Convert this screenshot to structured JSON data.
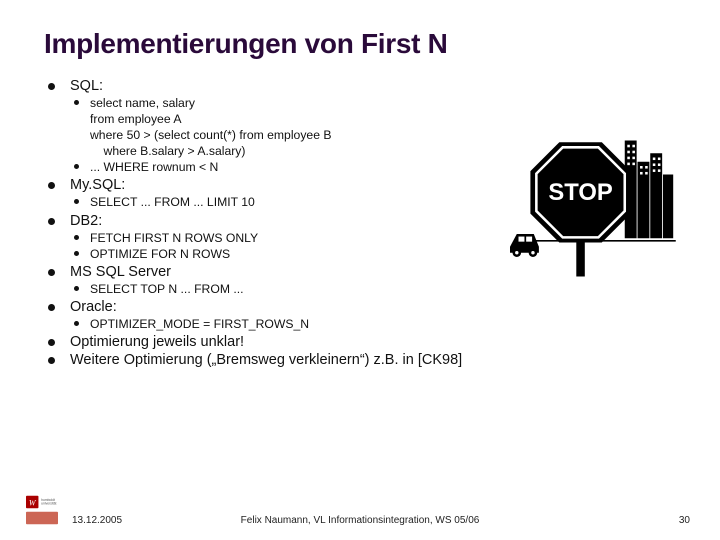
{
  "title": "Implementierungen von First N",
  "items": [
    {
      "label": "SQL:",
      "children": [
        {
          "label": "select name, salary\nfrom employee A\nwhere 50 > (select count(*) from employee B\n    where B.salary > A.salary)"
        },
        {
          "label": "... WHERE rownum < N"
        }
      ]
    },
    {
      "label": "My.SQL:",
      "children": [
        {
          "label": "SELECT ... FROM ... LIMIT 10"
        }
      ]
    },
    {
      "label": "DB2:",
      "children": [
        {
          "label": "FETCH FIRST N ROWS ONLY"
        },
        {
          "label": "OPTIMIZE FOR N ROWS"
        }
      ]
    },
    {
      "label": "MS SQL Server",
      "children": [
        {
          "label": "SELECT TOP N ... FROM ..."
        }
      ]
    },
    {
      "label": "Oracle:",
      "children": [
        {
          "label": "OPTIMIZER_MODE = FIRST_ROWS_N"
        }
      ]
    },
    {
      "label": "Optimierung jeweils unklar!"
    },
    {
      "label": "Weitere Optimierung („Bremsweg verkleinern“) z.B. in [CK98]"
    }
  ],
  "footer": {
    "date": "13.12.2005",
    "center": "Felix Naumann, VL Informationsintegration, WS 05/06",
    "page": "30"
  },
  "graphic_label": "STOP"
}
